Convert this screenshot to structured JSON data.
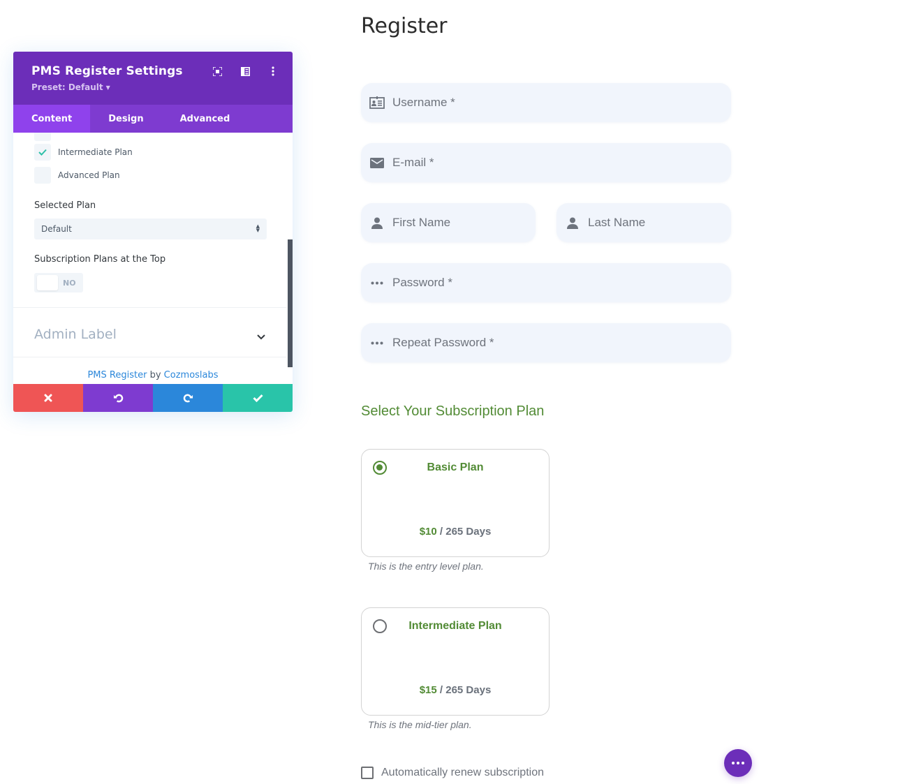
{
  "settings_panel": {
    "title": "PMS Register Settings",
    "preset": "Preset: Default",
    "header_icons": [
      "expand-icon",
      "sidebar-toggle-icon",
      "more-options-icon"
    ],
    "tabs": [
      {
        "label": "Content",
        "active": true
      },
      {
        "label": "Design",
        "active": false
      },
      {
        "label": "Advanced",
        "active": false
      }
    ],
    "plan_checkboxes": [
      {
        "label": "Intermediate Plan",
        "checked": true
      },
      {
        "label": "Advanced Plan",
        "checked": false
      }
    ],
    "selected_plan": {
      "label": "Selected Plan",
      "value": "Default"
    },
    "plans_at_top": {
      "label": "Subscription Plans at the Top",
      "value": "NO"
    },
    "admin_label": "Admin Label",
    "credit": {
      "module": "PMS Register",
      "by": "by",
      "author": "Cozmoslabs"
    },
    "footer_buttons": [
      "discard",
      "undo",
      "redo",
      "save"
    ],
    "colors": {
      "header": "#6c2eb9",
      "tabs": "#7e3bd0",
      "discard": "#ef5555",
      "undo": "#7e3bd0",
      "redo": "#2b87da",
      "save": "#29c4a9"
    }
  },
  "form": {
    "title": "Register",
    "fields": {
      "username": {
        "placeholder": "Username *",
        "icon": "id-card-icon"
      },
      "email": {
        "placeholder": "E-mail *",
        "icon": "envelope-icon"
      },
      "first_name": {
        "placeholder": "First Name",
        "icon": "user-icon"
      },
      "last_name": {
        "placeholder": "Last Name",
        "icon": "user-icon"
      },
      "password": {
        "placeholder": "Password *",
        "icon": "password-dots-icon"
      },
      "repeat_password": {
        "placeholder": "Repeat Password *",
        "icon": "password-dots-icon"
      }
    },
    "plans_heading": "Select Your Subscription Plan",
    "plans": [
      {
        "name": "Basic Plan",
        "price": "$10",
        "period": " / 265 Days",
        "description": "This is the entry level plan.",
        "selected": true
      },
      {
        "name": "Intermediate Plan",
        "price": "$15",
        "period": " / 265 Days",
        "description": "This is the mid-tier plan.",
        "selected": false
      }
    ],
    "auto_renew": {
      "label": "Automatically renew subscription",
      "checked": false
    },
    "accent_color": "#528b35"
  }
}
